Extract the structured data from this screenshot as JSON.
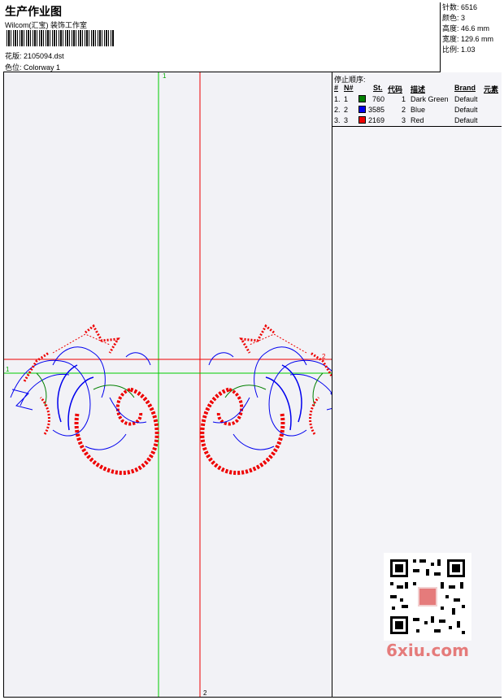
{
  "header": {
    "title": "生产作业图",
    "company": "Wilcom(汇宝) 装饰工作室",
    "design_label": "花版:",
    "design_file": "2105094.dst",
    "colorway_label": "色位:",
    "colorway_value": "Colorway 1"
  },
  "stats": {
    "stitches": "针数: 6516",
    "colors": "颜色: 3",
    "height": "高度: 46.6 mm",
    "width": "宽度: 129.6 mm",
    "scale": "比例: 1.03"
  },
  "stop_sequence": {
    "title": "停止顺序:",
    "headers": {
      "num": "#",
      "n": "N#",
      "stitches": "St.",
      "code": "代码",
      "desc": "描述",
      "brand": "Brand",
      "element": "元素"
    },
    "rows": [
      {
        "num": "1.",
        "n": "1",
        "color": "#008000",
        "stitches": "760",
        "code": "1",
        "desc": "Dark Green",
        "brand": "Default"
      },
      {
        "num": "2.",
        "n": "2",
        "color": "#0000ee",
        "stitches": "3585",
        "code": "2",
        "desc": "Blue",
        "brand": "Default"
      },
      {
        "num": "3.",
        "n": "3",
        "color": "#ee0000",
        "stitches": "2169",
        "code": "3",
        "desc": "Red",
        "brand": "Default"
      }
    ]
  },
  "guides": {
    "green_label": "1",
    "red_label": "2",
    "red_h_label": "2",
    "green_h_label": "1",
    "bottom_label": "2"
  },
  "colors": {
    "green": "#00cc00",
    "blue": "#0000ee",
    "red": "#ee0000"
  },
  "watermark": "6xiu.com"
}
